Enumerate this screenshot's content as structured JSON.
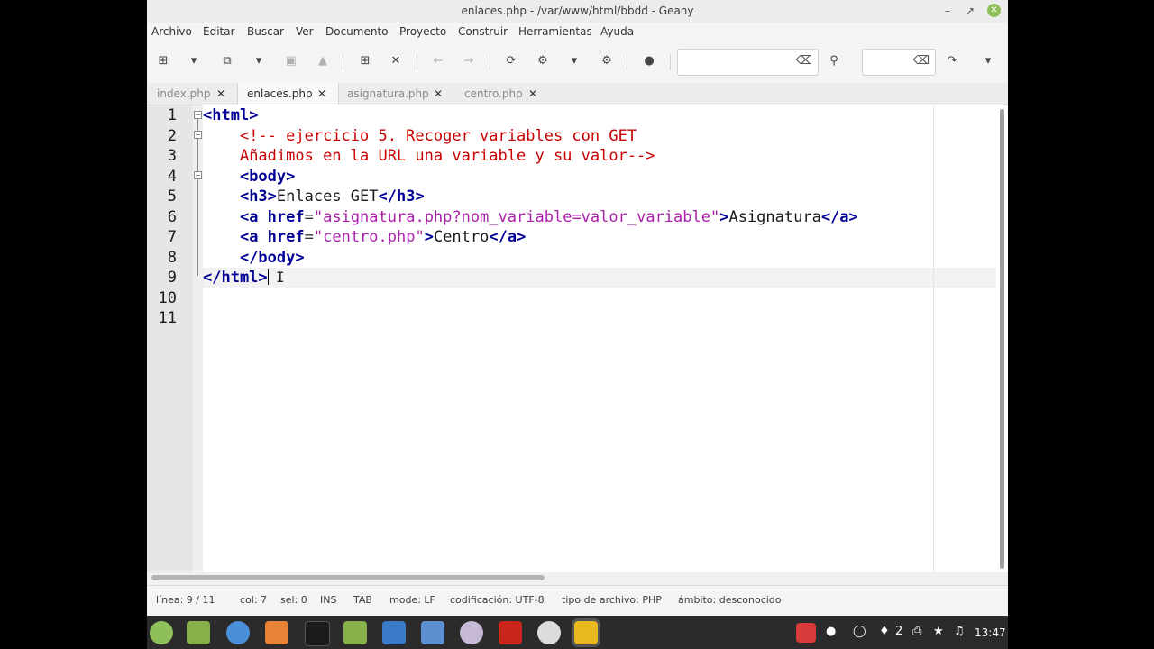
{
  "window": {
    "title": "enlaces.php - /var/www/html/bbdd - Geany"
  },
  "menu": [
    "Archivo",
    "Editar",
    "Buscar",
    "Ver",
    "Documento",
    "Proyecto",
    "Construir",
    "Herramientas",
    "Ayuda"
  ],
  "tabs": [
    {
      "label": "index.php",
      "active": false
    },
    {
      "label": "enlaces.php",
      "active": true
    },
    {
      "label": "asignatura.php",
      "active": false
    },
    {
      "label": "centro.php",
      "active": false
    }
  ],
  "editor": {
    "line_numbers": [
      "1",
      "2",
      "3",
      "4",
      "5",
      "6",
      "7",
      "8",
      "9",
      "10",
      "11"
    ],
    "lines": [
      "<html>",
      "    <!-- ejercicio 5. Recoger variables con GET",
      "    Añadimos en la URL una variable y su valor-->",
      "    <body>",
      "    <h3>Enlaces GET</h3>",
      "    <a href=\"asignatura.php?nom_variable=valor_variable\">Asignatura</a>",
      "    <a href=\"centro.php\">Centro</a>",
      "    </body>",
      "</html>",
      "",
      ""
    ],
    "cursor_line": 9
  },
  "status": {
    "linea": "línea: 9 / 11",
    "col": "col: 7",
    "sel": "sel: 0",
    "ins": "INS",
    "tab": "TAB",
    "mode": "mode: LF",
    "codificacion": "codificación: UTF-8",
    "tipo": "tipo de archivo: PHP",
    "ambito": "ámbito: desconocido"
  },
  "taskbar": {
    "clock": "13:47",
    "workspace": "2"
  },
  "colors": {
    "tag": "#000096",
    "string": "#ab20ab",
    "comment": "#c80000",
    "taskbar": "#2b2b2b"
  }
}
